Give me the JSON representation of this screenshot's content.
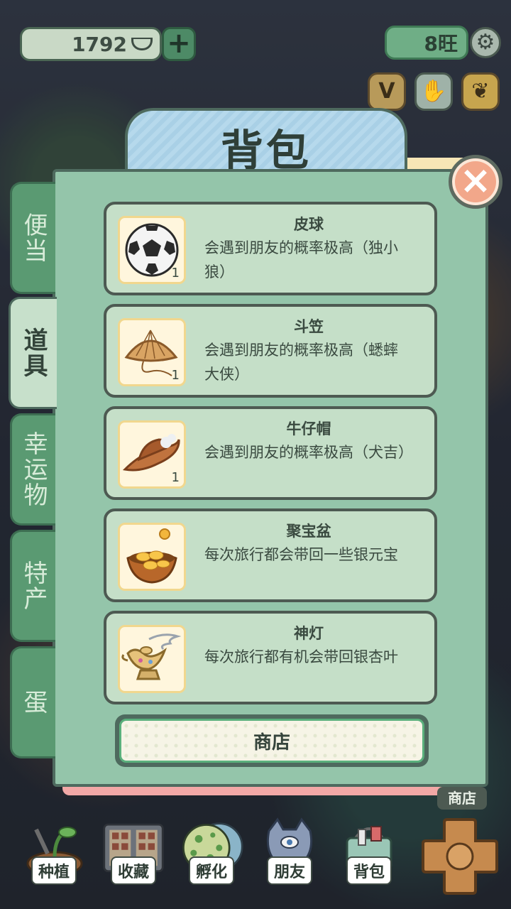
{
  "top_bar": {
    "currency_value": "1792",
    "plus_label": "+",
    "wang_value": "8旺",
    "icons": [
      "v-badge-icon",
      "hand-icon",
      "ginkgo-leaf-icon"
    ]
  },
  "panel": {
    "title": "背包",
    "close_label": "×"
  },
  "tabs": [
    {
      "label": "便当",
      "active": false
    },
    {
      "label": "道具",
      "active": true
    },
    {
      "label": "幸运物",
      "active": false
    },
    {
      "label": "特产",
      "active": false
    },
    {
      "label": "蛋",
      "active": false
    }
  ],
  "items": [
    {
      "name": "皮球",
      "desc": "会遇到朋友的概率极高（独小狼）",
      "count": "1",
      "icon": "soccer-ball-icon"
    },
    {
      "name": "斗笠",
      "desc": "会遇到朋友的概率极高（蟋蟀大侠）",
      "count": "1",
      "icon": "straw-hat-icon"
    },
    {
      "name": "牛仔帽",
      "desc": "会遇到朋友的概率极高（犬吉）",
      "count": "1",
      "icon": "cowboy-hat-icon"
    },
    {
      "name": "聚宝盆",
      "desc": "每次旅行都会带回一些银元宝",
      "count": "",
      "icon": "treasure-bowl-icon"
    },
    {
      "name": "神灯",
      "desc": "每次旅行都有机会带回银杏叶",
      "count": "",
      "icon": "magic-lamp-icon"
    }
  ],
  "shop_button": "商店",
  "shop_corner_label": "商店",
  "bottom_nav": [
    {
      "label": "种植",
      "icon": "planting-icon"
    },
    {
      "label": "收藏",
      "icon": "collection-icon"
    },
    {
      "label": "孵化",
      "icon": "egg-icon"
    },
    {
      "label": "朋友",
      "icon": "cat-friend-icon"
    },
    {
      "label": "背包",
      "icon": "basket-icon"
    }
  ]
}
